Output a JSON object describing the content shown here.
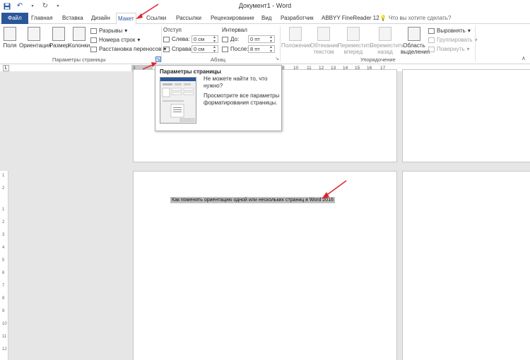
{
  "window": {
    "title": "Документ1 - Word",
    "quick_access": [
      "save-icon",
      "undo-icon",
      "redo-icon",
      "customize-icon"
    ]
  },
  "tabs": [
    {
      "label": "Файл"
    },
    {
      "label": "Главная"
    },
    {
      "label": "Вставка"
    },
    {
      "label": "Дизайн"
    },
    {
      "label": "Макет"
    },
    {
      "label": "Ссылки"
    },
    {
      "label": "Рассылки"
    },
    {
      "label": "Рецензирование"
    },
    {
      "label": "Вид"
    },
    {
      "label": "Разработчик"
    },
    {
      "label": "ABBYY FineReader 12"
    }
  ],
  "tell_me": "Что вы хотите сделать?",
  "ribbon": {
    "page_setup": {
      "fields": "Поля",
      "orientation": "Ориентация",
      "size": "Размер",
      "columns": "Колонки",
      "breaks": "Разрывы",
      "line_numbers": "Номера строк",
      "hyphenation": "Расстановка переносов",
      "group_label": "Параметры страницы"
    },
    "paragraph": {
      "indent_header": "Отступ",
      "left_label": "Слева:",
      "left_value": "0 см",
      "right_label": "Справа:",
      "right_value": "0 см",
      "spacing_header": "Интервал",
      "before_label": "До:",
      "before_value": "0 пт",
      "after_label": "После:",
      "after_value": "8 пт",
      "group_label": "Абзац"
    },
    "arrange": {
      "position": "Положение",
      "wrap_text_1": "Обтекание",
      "wrap_text_2": "текстом",
      "bring_forward_1": "Переместить",
      "bring_forward_2": "вперед",
      "send_backward_1": "Переместить",
      "send_backward_2": "назад",
      "selection_pane_1": "Область",
      "selection_pane_2": "выделения",
      "align": "Выровнять",
      "group": "Группировать",
      "rotate": "Повернуть",
      "group_label": "Упорядочение"
    }
  },
  "ruler": {
    "numbers": [
      "3",
      "9",
      "10",
      "11",
      "12",
      "13",
      "14",
      "15",
      "16",
      "17"
    ]
  },
  "vruler": {
    "numbers": [
      "1",
      "2",
      "1",
      "2",
      "3",
      "4",
      "5",
      "6",
      "7",
      "8",
      "9",
      "10",
      "11",
      "12"
    ]
  },
  "tooltip": {
    "title": "Параметры страницы",
    "text1": "Не можете найти то, что нужно?",
    "text2": "Просмотрите все параметры форматирования страницы."
  },
  "document": {
    "selected_text": "Как поменять ориентацию одной или нескольких страниц в Word 2016"
  },
  "colors": {
    "accent": "#2b579a",
    "annotation_arrow": "#e0242b"
  }
}
